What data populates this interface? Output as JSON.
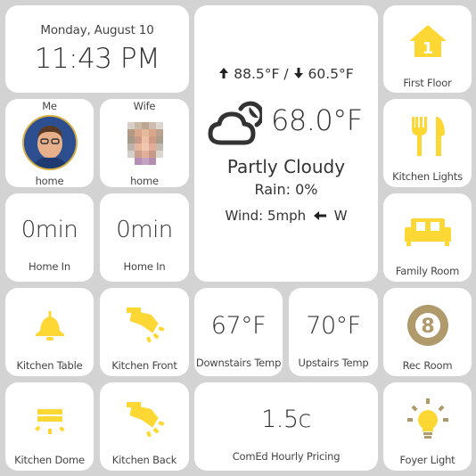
{
  "clock": {
    "date": "Monday, August 10",
    "time": "11:43 PM"
  },
  "people": [
    {
      "name": "Me",
      "status": "home"
    },
    {
      "name": "Wife",
      "status": "home"
    }
  ],
  "eta": [
    {
      "value": "0min",
      "label": "Home In"
    },
    {
      "value": "0min",
      "label": "Home In"
    }
  ],
  "weather": {
    "high": "88.5°F",
    "separator": "/",
    "low": "60.5°F",
    "temp": "68.0°F",
    "condition": "Partly Cloudy",
    "rain": "Rain: 0%",
    "wind": "Wind: 5mph",
    "wind_dir": "W"
  },
  "rooms": [
    {
      "label": "First Floor",
      "icon": "first-floor-icon",
      "badge": "1"
    },
    {
      "label": "Kitchen Lights",
      "icon": "fork-knife-icon"
    },
    {
      "label": "Family Room",
      "icon": "sofa-icon"
    },
    {
      "label": "Rec Room",
      "icon": "eight-ball-icon",
      "badge": "8"
    },
    {
      "label": "Foyer Light",
      "icon": "lightbulb-icon"
    }
  ],
  "lights": [
    {
      "label": "Kitchen Table",
      "icon": "pendant-lamp-icon"
    },
    {
      "label": "Kitchen Front",
      "icon": "spotlight-icon"
    },
    {
      "label": "Kitchen Dome",
      "icon": "dome-light-icon"
    },
    {
      "label": "Kitchen Back",
      "icon": "spotlight-icon"
    }
  ],
  "temps": [
    {
      "value": "67°F",
      "label": "Downstairs Temp"
    },
    {
      "value": "70°F",
      "label": "Upstairs Temp"
    }
  ],
  "pricing": {
    "value": "1.5c",
    "label": "ComEd Hourly Pricing"
  },
  "colors": {
    "accent": "#fdd835",
    "eight_ball": "#b09a6b",
    "background": "#d3d3d3",
    "tile": "#ffffff",
    "text": "#333333"
  }
}
